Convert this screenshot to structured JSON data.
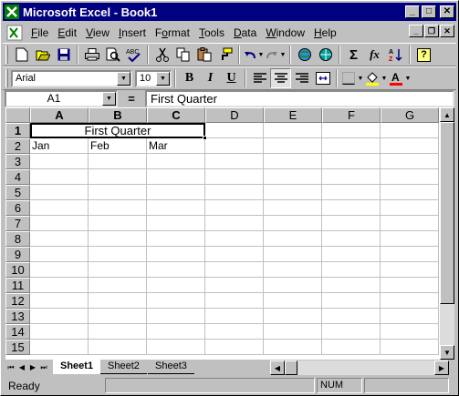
{
  "window": {
    "title": "Microsoft Excel - Book1"
  },
  "title_buttons": {
    "minimize": "_",
    "maximize": "□",
    "close": "✕"
  },
  "menus": [
    {
      "label": "File",
      "hot": "F"
    },
    {
      "label": "Edit",
      "hot": "E"
    },
    {
      "label": "View",
      "hot": "V"
    },
    {
      "label": "Insert",
      "hot": "I"
    },
    {
      "label": "Format",
      "hot": "o"
    },
    {
      "label": "Tools",
      "hot": "T"
    },
    {
      "label": "Data",
      "hot": "D"
    },
    {
      "label": "Window",
      "hot": "W"
    },
    {
      "label": "Help",
      "hot": "H"
    }
  ],
  "standard_toolbar": [
    "new-icon",
    "open-icon",
    "save-icon",
    "print-icon",
    "print-preview-icon",
    "spelling-icon",
    "cut-icon",
    "copy-icon",
    "paste-icon",
    "format-painter-icon",
    "undo-icon",
    "redo-icon",
    "hyperlink-icon",
    "web-toolbar-icon",
    "autosum-icon",
    "paste-function-icon",
    "sort-ascending-icon",
    "help-icon"
  ],
  "toolbar_glyphs": {
    "autosum": "Σ",
    "function": "fx",
    "help": "?"
  },
  "formatting": {
    "font": "Arial",
    "size": "10",
    "bold": "B",
    "italic": "I",
    "underline": "U"
  },
  "formula_bar": {
    "name_box": "A1",
    "equals": "=",
    "contents": "First Quarter"
  },
  "columns": [
    "A",
    "B",
    "C",
    "D",
    "E",
    "F",
    "G"
  ],
  "rows": [
    "1",
    "2",
    "3",
    "4",
    "5",
    "6",
    "7",
    "8",
    "9",
    "10",
    "11",
    "12",
    "13",
    "14",
    "15"
  ],
  "cells": {
    "A1": "First Quarter",
    "A2": "Jan",
    "B2": "Feb",
    "C2": "Mar"
  },
  "sheets": [
    "Sheet1",
    "Sheet2",
    "Sheet3"
  ],
  "status": {
    "ready": "Ready",
    "num": "NUM"
  },
  "colors": {
    "title_bar": "#000080",
    "face": "#c0c0c0"
  }
}
